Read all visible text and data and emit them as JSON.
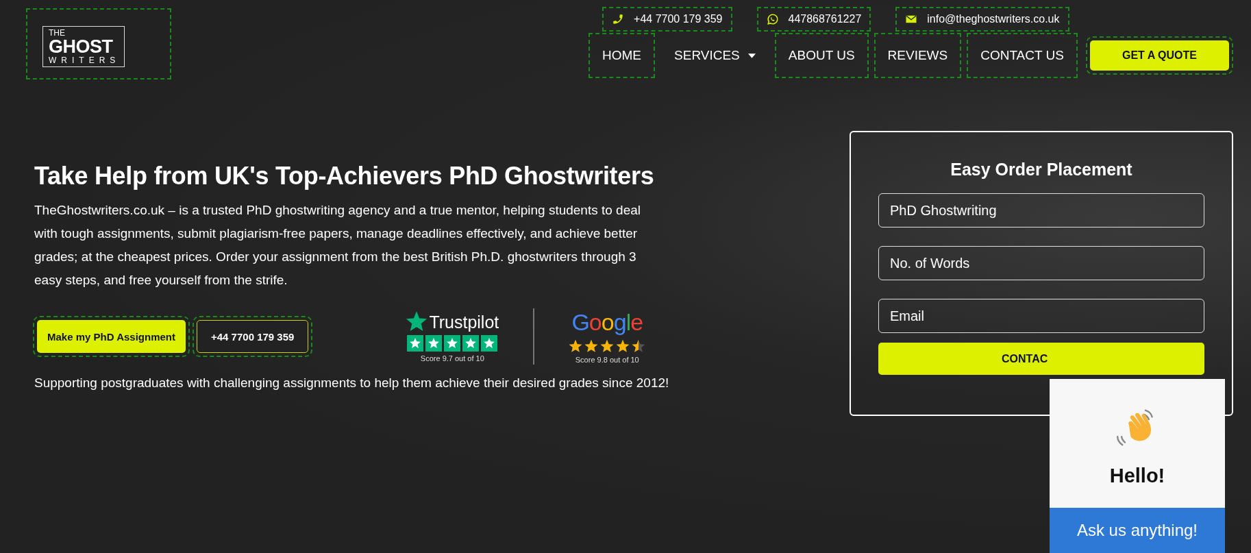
{
  "logo": {
    "top": "THE",
    "middle": "GHOST",
    "bottom": "WRITERS"
  },
  "contacts": [
    {
      "kind": "phone",
      "text": "+44 7700 179 359"
    },
    {
      "kind": "whatsapp",
      "text": "447868761227"
    },
    {
      "kind": "email",
      "text": "info@theghostwriters.co.uk"
    }
  ],
  "nav": [
    {
      "label": "HOME",
      "dropdown": false
    },
    {
      "label": "SERVICES",
      "dropdown": true
    },
    {
      "label": "ABOUT US",
      "dropdown": false
    },
    {
      "label": "REVIEWS",
      "dropdown": false
    },
    {
      "label": "CONTACT US",
      "dropdown": false
    }
  ],
  "quote_button": "GET A QUOTE",
  "hero": {
    "title": "Take Help from UK's Top-Achievers PhD Ghostwriters",
    "text": "TheGhostwriters.co.uk – is a trusted PhD ghostwriting agency and a true mentor, helping students to deal with tough assignments, submit plagiarism-free papers, manage deadlines effectively, and achieve better grades; at the cheapest prices. Order your assignment from the best British Ph.D. ghostwriters through 3 easy steps, and free yourself from the strife.",
    "buttons": [
      {
        "kind": "primary",
        "label": "Make my PhD Assignment"
      },
      {
        "kind": "outline",
        "label": "+44 7700 179 359"
      }
    ],
    "ratings": [
      {
        "kind": "trustpilot",
        "brand": "Trustpilot",
        "stars": 5,
        "score": "Score 9.7  out of 10"
      },
      {
        "kind": "google",
        "brand": "Google",
        "stars": 4.5,
        "score": "Score 9.8 out of 10"
      }
    ],
    "note": "Supporting postgraduates with challenging assignments to help them achieve their desired grades since 2012!"
  },
  "form": {
    "title": "Easy Order Placement",
    "fields": [
      {
        "value": "PhD Ghostwriting"
      },
      {
        "placeholder": "No. of Words"
      },
      {
        "placeholder": "Email"
      }
    ],
    "button": "CONTAC"
  },
  "chat": {
    "greeting": "Hello!",
    "button": "Ask us anything!"
  }
}
